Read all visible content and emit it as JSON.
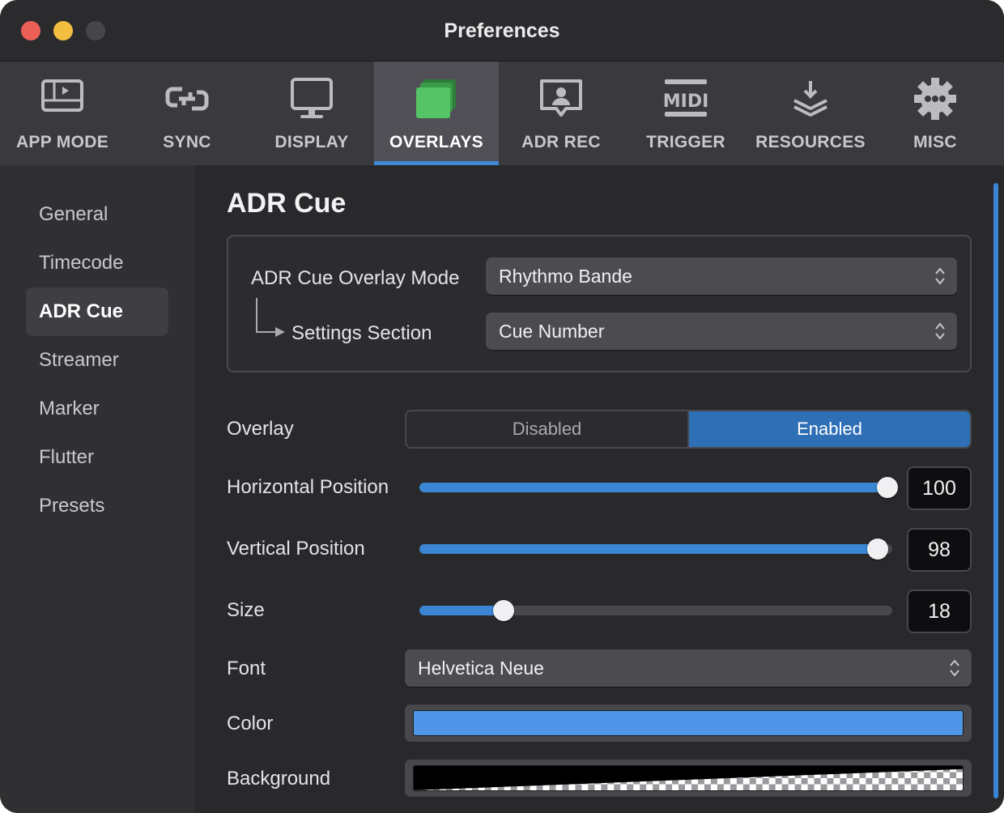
{
  "window": {
    "title": "Preferences"
  },
  "toolbar": {
    "items": [
      {
        "label": "APP MODE",
        "icon": "app-mode-icon"
      },
      {
        "label": "SYNC",
        "icon": "sync-icon"
      },
      {
        "label": "DISPLAY",
        "icon": "display-icon"
      },
      {
        "label": "OVERLAYS",
        "icon": "overlays-icon",
        "active": true
      },
      {
        "label": "ADR REC",
        "icon": "adr-rec-icon"
      },
      {
        "label": "TRIGGER",
        "icon": "midi-icon"
      },
      {
        "label": "RESOURCES",
        "icon": "resources-icon"
      },
      {
        "label": "MISC",
        "icon": "gear-icon"
      }
    ],
    "accent": "#3e88d6"
  },
  "sidebar": {
    "items": [
      {
        "label": "General"
      },
      {
        "label": "Timecode"
      },
      {
        "label": "ADR Cue",
        "active": true
      },
      {
        "label": "Streamer"
      },
      {
        "label": "Marker"
      },
      {
        "label": "Flutter"
      },
      {
        "label": "Presets"
      }
    ]
  },
  "main": {
    "heading": "ADR Cue",
    "mode": {
      "label": "ADR Cue Overlay Mode",
      "value": "Rhythmo Bande"
    },
    "section": {
      "label": "Settings Section",
      "value": "Cue Number"
    },
    "overlay": {
      "label": "Overlay",
      "options": [
        "Disabled",
        "Enabled"
      ],
      "selected": "Enabled"
    },
    "horizontal": {
      "label": "Horizontal Position",
      "value": "100",
      "fraction": 1.0
    },
    "vertical": {
      "label": "Vertical Position",
      "value": "98",
      "fraction": 0.98
    },
    "size": {
      "label": "Size",
      "value": "18",
      "fraction": 0.18
    },
    "font": {
      "label": "Font",
      "value": "Helvetica Neue"
    },
    "color": {
      "label": "Color",
      "swatch": "#4f95e8"
    },
    "background": {
      "label": "Background"
    }
  }
}
